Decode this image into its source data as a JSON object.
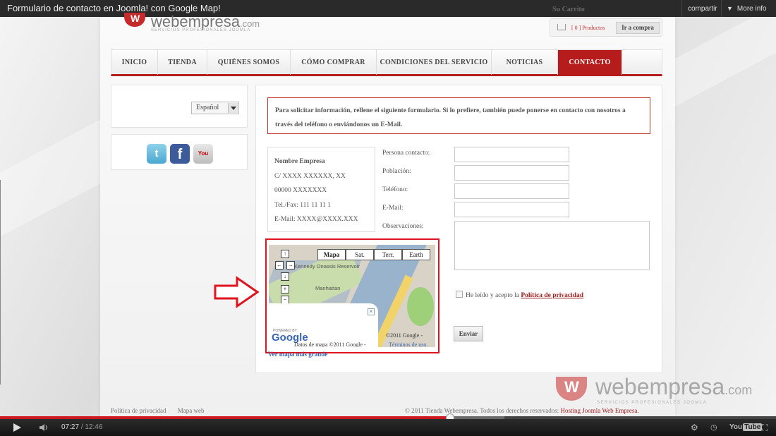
{
  "video": {
    "title": "Formulario de contacto en Joomla! con Google Map!",
    "share_label": "compartir",
    "more_info_label": "More info",
    "current_time": "07:27",
    "separator": "/",
    "duration": "12:46",
    "progress": 0.58,
    "buffered": 0.65,
    "youtube_label": "You",
    "youtube_label_tube": "Tube"
  },
  "header": {
    "logo_mark": "W",
    "logo_name": "webempresa",
    "logo_suffix": ".com",
    "logo_tagline": "SERVICIOS PROFESIONALES JOOMLA",
    "cart_title": "Su Carrito",
    "cart_count": "[ 0 ] Productos",
    "cart_button": "Ir a compra"
  },
  "nav": {
    "items": [
      {
        "label": "Inicio"
      },
      {
        "label": "Tienda"
      },
      {
        "label": "Quiénes somos"
      },
      {
        "label": "Cómo comprar"
      },
      {
        "label": "Condiciones del servicio"
      },
      {
        "label": "Noticias"
      },
      {
        "label": "Contacto",
        "active": true
      }
    ]
  },
  "sidebar": {
    "language": "Español",
    "social": [
      "twitter-icon",
      "facebook-icon",
      "youtube-icon"
    ],
    "twitter_glyph": "t",
    "facebook_glyph": "f",
    "youtube_glyph": "You"
  },
  "contact": {
    "notice": "Para solicitar información, rellene el siguiente formulario. Si lo prefiere, también puede ponerse en contacto con nosotros a través del teléfono o enviándonos un E-Mail.",
    "company": {
      "name": "Nombre Empresa",
      "address": "C/ XXXX XXXXXX, XX",
      "postal": "00000 XXXXXXX",
      "phone": "Tel./Fax: 111 11 11 1",
      "email": "E-Mail: XXXX@XXXX.XXX"
    },
    "fields": {
      "contact_person": "Persona contacto:",
      "city": "Población:",
      "phone": "Teléfono:",
      "email": "E-Mail:",
      "notes": "Observaciones:"
    },
    "privacy_text": "He leído y acepto la",
    "privacy_link": "Política de privacidad",
    "send_button": "Enviar"
  },
  "map": {
    "types": [
      "Mapa",
      "Sat.",
      "Terr.",
      "Earth"
    ],
    "selected_type": "Mapa",
    "label_reservoir": "Kennedy Onassis Reservoir",
    "label_area": "Manhattan",
    "powered_by": "POWERED BY",
    "google": "Google",
    "map_data": "Datos de mapa ©2011 Google -",
    "copyright": "©2011 Google -",
    "terms": "Términos de uso",
    "bigger_map": "Ver mapa más grande"
  },
  "footer": {
    "privacy": "Política de privacidad",
    "sitemap": "Mapa web",
    "rights": "© 2011 Tienda Webempresa. Todos los derechos reservados:",
    "hosting": "Hosting Joomla Web Empresa."
  },
  "colors": {
    "brand_red": "#b71c1c",
    "highlight_red": "#e0141e",
    "progress_red": "#cc181e"
  }
}
